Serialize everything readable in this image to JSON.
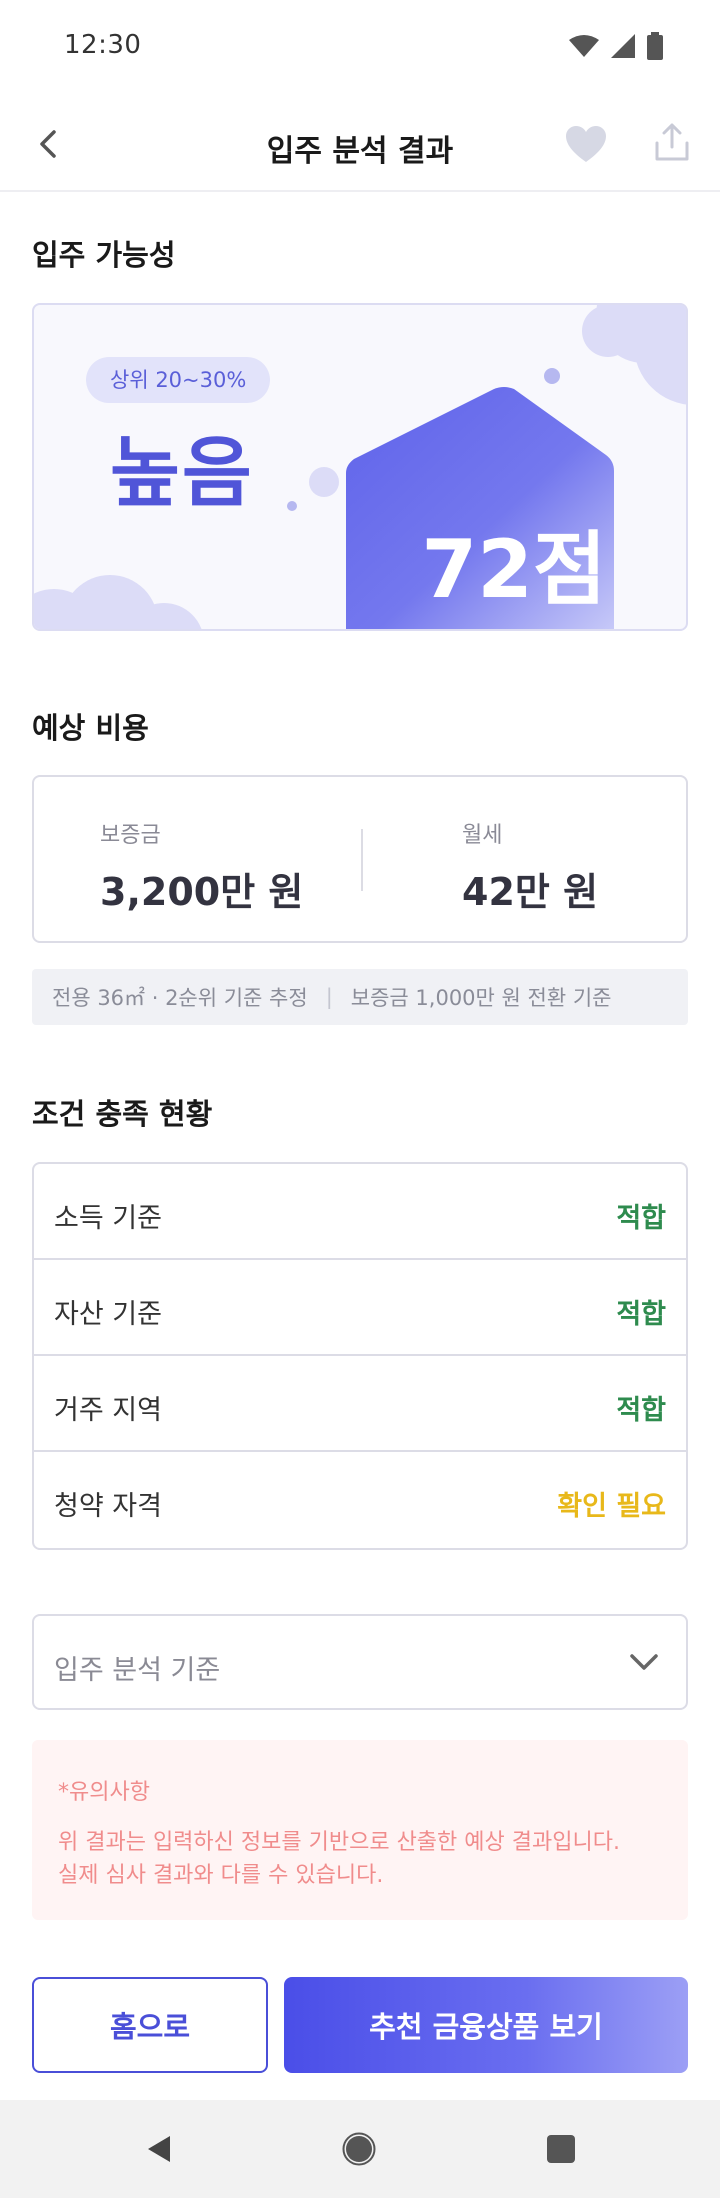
{
  "status_bar": {
    "time": "12:30"
  },
  "header": {
    "title": "입주 분석 결과"
  },
  "possibility": {
    "section_title": "입주 가능성",
    "rank_badge": "상위 20~30%",
    "level": "높음",
    "score": "72점"
  },
  "cost": {
    "section_title": "예상 비용",
    "deposit_label": "보증금",
    "deposit_value": "3,200만 원",
    "rent_label": "월세",
    "rent_value": "42만 원",
    "note_left": "전용 36㎡ · 2순위 기준 추정",
    "note_right": "보증금 1,000만 원 전환 기준"
  },
  "conditions": {
    "section_title": "조건 충족 현황",
    "items": [
      {
        "label": "소득 기준",
        "status": "적합",
        "color": "#2e8b4e"
      },
      {
        "label": "자산 기준",
        "status": "적합",
        "color": "#2e8b4e"
      },
      {
        "label": "거주 지역",
        "status": "적합",
        "color": "#2e8b4e"
      },
      {
        "label": "청약 자격",
        "status": "확인 필요",
        "color": "#e8b81a"
      }
    ]
  },
  "criteria": {
    "label": "입주 분석 기준"
  },
  "notice": {
    "title": "*유의사항",
    "line1": "위 결과는 입력하신 정보를 기반으로 산출한 예상 결과입니다.",
    "line2": "실제 심사 결과와 다를 수 있습니다."
  },
  "buttons": {
    "home": "홈으로",
    "recommend": "추천 금융상품 보기"
  },
  "colors": {
    "accent": "#4a4fd8",
    "ok": "#2e8b4e",
    "warn": "#e8b81a",
    "notice": "#f08c8c"
  },
  "icons": {
    "back": "chevron-left-icon",
    "favorite": "heart-icon",
    "share": "share-icon",
    "dropdown": "chevron-down-icon"
  }
}
